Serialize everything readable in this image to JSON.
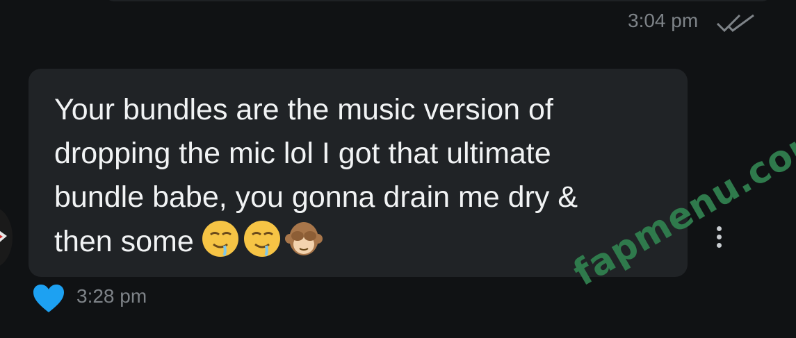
{
  "previous_message": {
    "time": "3:04 pm",
    "status_icon": "double-check-icon"
  },
  "message": {
    "text": "Your bundles are the music version of\ndropping the mic lol I got that ultimate\nbundle babe, you gonna drain me dry &\nthen some",
    "emojis": [
      "drooling-face-icon",
      "drooling-face-icon",
      "see-no-evil-monkey-icon"
    ],
    "time": "3:28 pm",
    "reaction_icon": "heart-icon",
    "reaction_color": "#1da1f2",
    "bubble_color": "#202326"
  },
  "menu": {
    "icon": "more-vertical-icon"
  },
  "watermark": {
    "text": "fapmenu.com",
    "color": "#2f7a4c"
  },
  "colors": {
    "background": "#101214",
    "text": "#f1f3f4",
    "meta_text": "#7e8388"
  }
}
